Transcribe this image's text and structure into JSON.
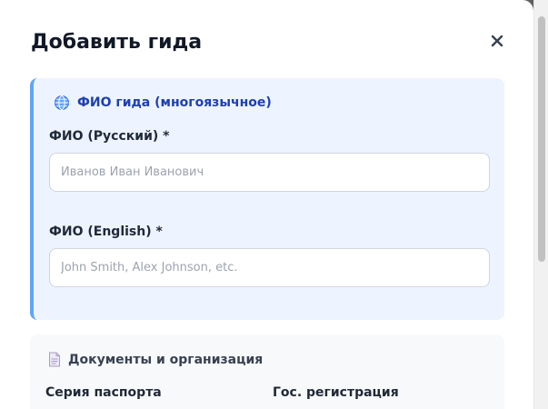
{
  "modal": {
    "title": "Добавить гида",
    "close_icon": "close-icon"
  },
  "names_section": {
    "icon": "globe-icon",
    "title": "ФИО гида (многоязычное)",
    "fields": [
      {
        "label": "ФИО (Русский) *",
        "value": "",
        "placeholder": "Иванов Иван Иванович"
      },
      {
        "label": "ФИО (English) *",
        "value": "",
        "placeholder": "John Smith, Alex Johnson, etc."
      }
    ]
  },
  "docs_section": {
    "icon": "document-icon",
    "title": "Документы и организация",
    "passport_label": "Серия паспорта",
    "registration_label": "Гос. регистрация"
  },
  "colors": {
    "accent": "#60a5fa",
    "section_bg": "#eef4ff",
    "section_title": "#1e40af"
  }
}
